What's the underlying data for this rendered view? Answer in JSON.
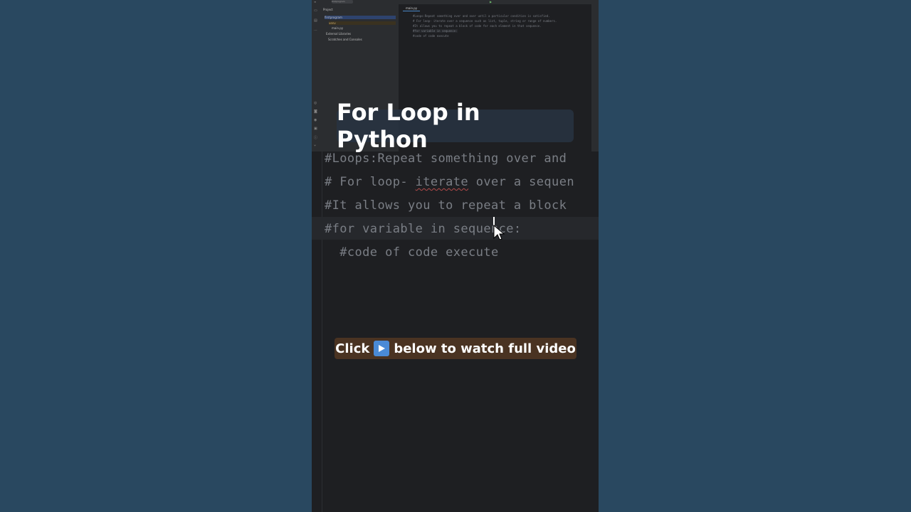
{
  "overlay": {
    "title": "For Loop in Python",
    "cta_before": "Click",
    "cta_after": "below to watch full video",
    "cta_icon": "play-icon"
  },
  "ide": {
    "project_name": "firstprogram",
    "tree": {
      "header": "Project",
      "root": "firstprogram",
      "venv": "venv",
      "file": "main.py",
      "external": "External Libraries",
      "scratches": "Scratches and Consoles"
    },
    "tab": "main.py"
  },
  "code": {
    "line1": "#Loops:Repeat something over and",
    "line2_pre": "# For loop- ",
    "line2_err": "iterate",
    "line2_post": " over a sequen",
    "line3": "#It allows you to repeat a block",
    "line4": "#for variable in sequence:",
    "line5": "  #code of code execute"
  },
  "small_code": {
    "l1": "#Loops:Repeat something over and over until a particular condition is satisfied.",
    "l2": "# For loop- iterate over a sequence such as list, tuple, string or range of numbers.",
    "l3": "#It allows you to repeat a block of code for each element in that sequence.",
    "l4": "#for variable in sequence:",
    "l5": "  #code of code execute"
  },
  "colors": {
    "background": "#2b4a62",
    "editor": "#1e1f22",
    "comment": "#7a7e85",
    "cta_bg": "#4a3322",
    "title_bg": "#283442"
  }
}
